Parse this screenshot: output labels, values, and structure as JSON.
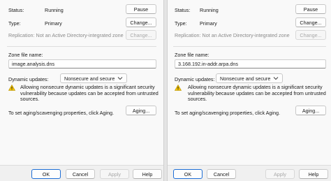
{
  "left": {
    "status_label": "Status:",
    "status_value": "Running",
    "pause_label": "Pause",
    "type_label": "Type:",
    "type_value": "Primary",
    "change_label": "Change...",
    "replication_text": "Replication: Not an Active Directory-integrated zone",
    "change2_label": "Change...",
    "zone_file_label": "Zone file name:",
    "zone_file_value": "image.analysis.dns",
    "dynamic_label": "Dynamic updates:",
    "dynamic_value": "Nonsecure and secure",
    "warning_text": "Allowing nonsecure dynamic updates is a significant security vulnerability because updates can be accepted from untrusted sources.",
    "aging_text": "To set aging/scavenging properties, click Aging.",
    "aging_button": "Aging...",
    "ok": "OK",
    "cancel": "Cancel",
    "apply": "Apply",
    "help": "Help"
  },
  "right": {
    "status_label": "Status:",
    "status_value": "Running",
    "pause_label": "Pause",
    "type_label": "Type:",
    "type_value": "Primary",
    "change_label": "Change...",
    "replication_text": "Replication: Not an Active Directory-integrated zone",
    "change2_label": "Change...",
    "zone_file_label": "Zone file name:",
    "zone_file_value": "3.168.192.in-addr.arpa.dns",
    "dynamic_label": "Dynamic updates:",
    "dynamic_value": "Nonsecure and secure",
    "warning_text": "Allowing nonsecure dynamic updates is a significant security vulnerability because updates can be accepted from untrusted sources.",
    "aging_text": "To set aging/scavenging properties, click Aging.",
    "aging_button": "Aging...",
    "ok": "OK",
    "cancel": "Cancel",
    "apply": "Apply",
    "help": "Help"
  },
  "icons": {
    "warning": "warning-icon",
    "dropdown": "chevron-down-icon"
  },
  "colors": {
    "accent": "#1f6fd6",
    "warning": "#f2c200"
  }
}
